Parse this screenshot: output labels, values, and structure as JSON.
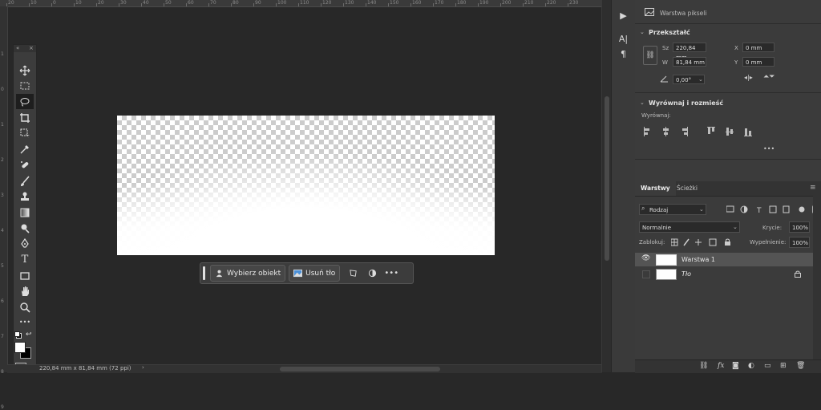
{
  "ruler": {
    "top_ticks": [
      "20",
      "10",
      "0",
      "10",
      "20",
      "30",
      "40",
      "50",
      "60",
      "70",
      "80",
      "90",
      "100",
      "110",
      "120",
      "130",
      "140",
      "150",
      "160",
      "170",
      "180",
      "190",
      "200",
      "210",
      "220",
      "230"
    ],
    "left_ticks": [
      "1",
      "0",
      "1",
      "2",
      "3",
      "4",
      "5",
      "6",
      "7",
      "8",
      "9"
    ]
  },
  "toolbar": {
    "collapse": "«",
    "close": "×",
    "tools": [
      "move-tool",
      "marquee-tool",
      "lasso-tool",
      "crop-tool",
      "frame-tool",
      "eyedropper-tool",
      "healing-brush-tool",
      "brush-tool",
      "clone-stamp-tool",
      "gradient-tool",
      "blur-tool",
      "pen-tool",
      "type-tool",
      "rectangle-tool",
      "hand-tool",
      "zoom-tool",
      "more-tools"
    ],
    "type_glyph": "T",
    "more_glyph": "•••"
  },
  "context_bar": {
    "select_subject": "Wybierz obiekt",
    "remove_bg": "Usuń tło",
    "more": "•••"
  },
  "status": {
    "doc_info": "220,84 mm x 81,84 mm (72 ppi)"
  },
  "properties": {
    "layer_type": "Warstwa pikseli",
    "transform_title": "Przekształć",
    "w_label": "Sz",
    "w_value": "220,84 mm",
    "h_label": "W",
    "h_value": "81,84 mm",
    "x_label": "X",
    "x_value": "0 mm",
    "y_label": "Y",
    "y_value": "0 mm",
    "angle_value": "0,00°",
    "align_title": "Wyrównaj i rozmieść",
    "align_label": "Wyrównaj:",
    "more": "•••"
  },
  "layers": {
    "tab_layers": "Warstwy",
    "tab_paths": "Ścieżki",
    "filter_kind": "Rodzaj",
    "blend_mode": "Normalnie",
    "opacity_label": "Krycie:",
    "opacity_value": "100%",
    "lock_label": "Zablokuj:",
    "fill_label": "Wypełnienie:",
    "fill_value": "100%",
    "items": [
      {
        "name": "Warstwa 1",
        "visible": true,
        "selected": true
      },
      {
        "name": "Tło",
        "visible": false,
        "locked": true
      }
    ],
    "footer": [
      "link",
      "fx",
      "mask",
      "adjust",
      "group",
      "new",
      "delete"
    ]
  },
  "colors": {
    "foreground": "#ffffff",
    "background": "#000000",
    "accent": "#1473e6"
  }
}
